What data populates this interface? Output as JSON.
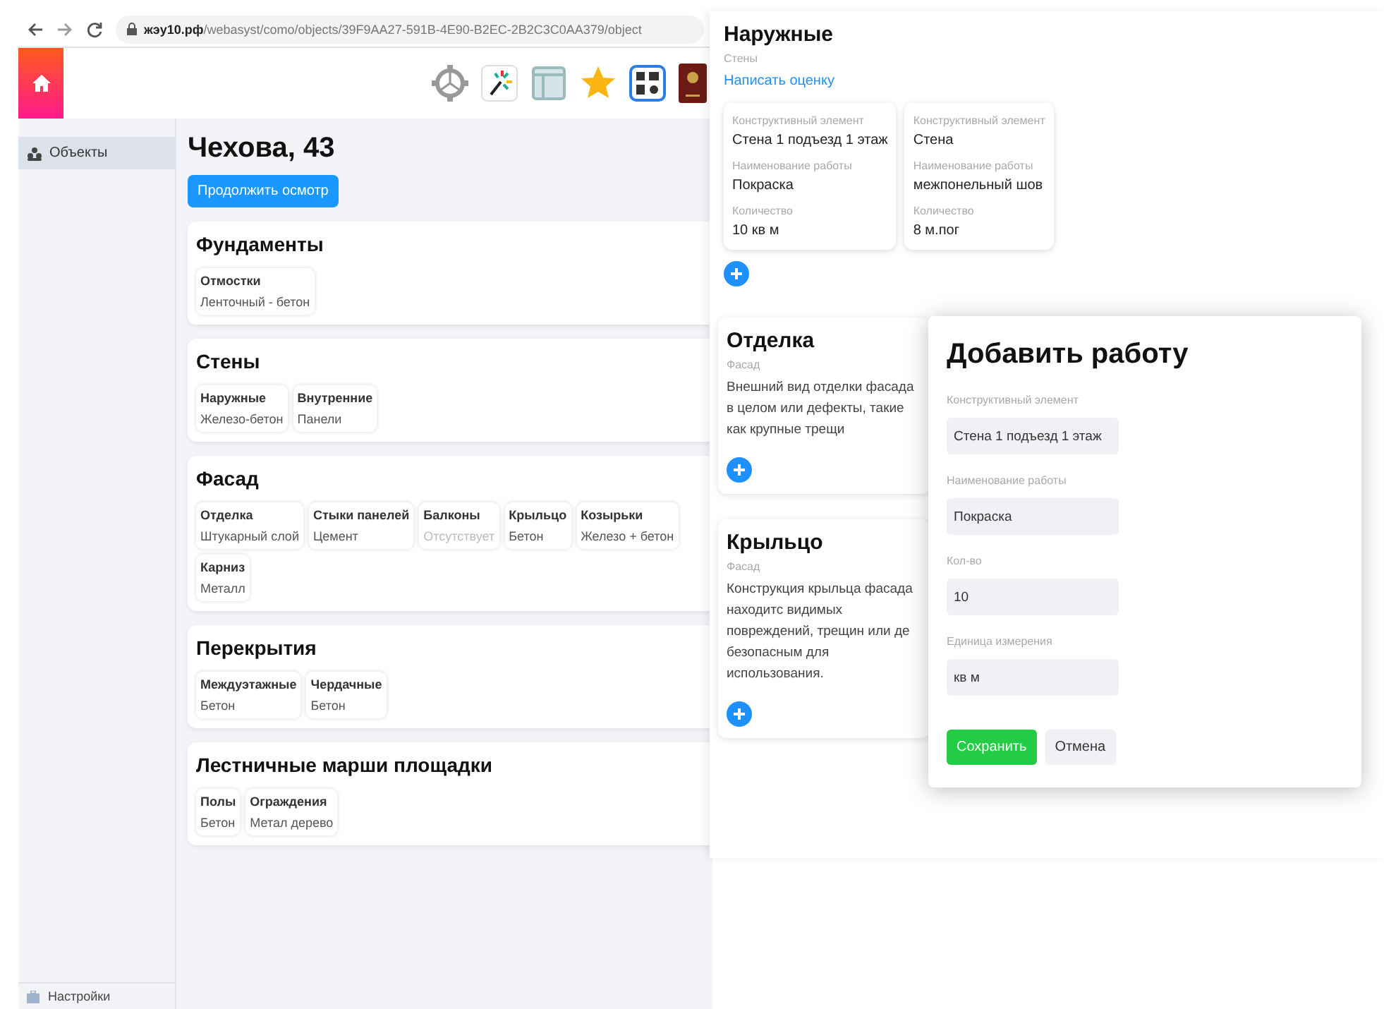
{
  "browser": {
    "url": "**жэу10.рф**/webasyst/como/objects/39F9AA27-591B-4E90-B2EC-2B2C3C0AA379/object"
  },
  "sidebar": {
    "items": [
      {
        "label": "Объекты",
        "selected": true
      }
    ],
    "footer": "Настройки"
  },
  "object": {
    "title": "Чехова, 43",
    "continue_button": "Продолжить осмотр",
    "sections": [
      {
        "title": "Фундаменты",
        "items": [
          {
            "name": "Отмостки",
            "value": "Ленточный - бетон",
            "muted": false
          }
        ]
      },
      {
        "title": "Стены",
        "items": [
          {
            "name": "Наружные",
            "value": "Железо-бетон",
            "muted": false
          },
          {
            "name": "Внутренние",
            "value": "Панели",
            "muted": false
          }
        ]
      },
      {
        "title": "Фасад",
        "items": [
          {
            "name": "Отделка",
            "value": "Штукарный слой",
            "muted": false
          },
          {
            "name": "Стыки панелей",
            "value": "Цемент",
            "muted": false
          },
          {
            "name": "Балконы",
            "value": "Отсутствует",
            "muted": true
          },
          {
            "name": "Крыльцо",
            "value": "Бетон",
            "muted": false
          },
          {
            "name": "Козырьки",
            "value": "Железо + бетон",
            "muted": false
          },
          {
            "name": "Карниз",
            "value": "Металл",
            "muted": false
          }
        ]
      },
      {
        "title": "Перекрытия",
        "items": [
          {
            "name": "Междуэтажные",
            "value": "Бетон",
            "muted": false
          },
          {
            "name": "Чердачные",
            "value": "Бетон",
            "muted": false
          }
        ]
      },
      {
        "title": "Лестничные марши площадки",
        "items": [
          {
            "name": "Полы",
            "value": "Бетон",
            "muted": false
          },
          {
            "name": "Ограждения",
            "value": "Метал дерево",
            "muted": false
          }
        ]
      }
    ]
  },
  "element_panel": {
    "title": "Наружные",
    "subtitle": "Стены",
    "review_link": "Написать оценку",
    "works": [
      {
        "fields": [
          {
            "label": "Конструктивный элемент",
            "value": "Стена 1 подъезд 1 этаж"
          },
          {
            "label": "Наименование работы",
            "value": "Покраска"
          },
          {
            "label": "Количество",
            "value": "10 кв м"
          }
        ]
      },
      {
        "fields": [
          {
            "label": "Конструктивный элемент",
            "value": "Стена"
          },
          {
            "label": "Наименование работы",
            "value": "межпонельный шов"
          },
          {
            "label": "Количество",
            "value": "8 м.пог"
          }
        ]
      }
    ]
  },
  "inspection_cards": [
    {
      "title": "Отделка",
      "category": "Фасад",
      "text": "Внешний вид отделки фасада в целом или дефекты, такие как крупные трещи"
    },
    {
      "title": "Крыльцо",
      "category": "Фасад",
      "text": "Конструкция крыльца фасада находитс видимых повреждений, трещин или де безопасным для использования."
    }
  ],
  "add_work_dialog": {
    "title": "Добавить работу",
    "fields": [
      {
        "label": "Конструктивный элемент",
        "value": "Стена 1 подъезд 1 этаж"
      },
      {
        "label": "Наименование работы",
        "value": "Покраска"
      },
      {
        "label": "Кол-во",
        "value": "10"
      },
      {
        "label": "Единица измерения",
        "value": "кв м"
      }
    ],
    "save_button": "Сохранить",
    "cancel_button": "Отмена"
  }
}
